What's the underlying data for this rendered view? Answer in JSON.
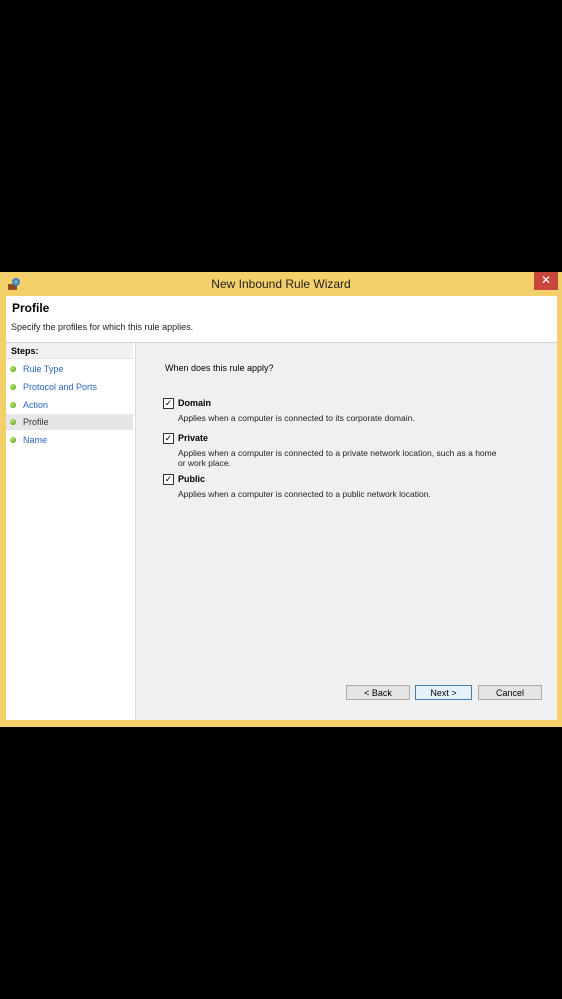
{
  "window": {
    "title": "New Inbound Rule Wizard",
    "close_glyph": "✕"
  },
  "header": {
    "title": "Profile",
    "description": "Specify the profiles for which this rule applies."
  },
  "sidebar": {
    "steps_label": "Steps:",
    "items": [
      {
        "label": "Rule Type"
      },
      {
        "label": "Protocol and Ports"
      },
      {
        "label": "Action"
      },
      {
        "label": "Profile"
      },
      {
        "label": "Name"
      }
    ]
  },
  "main": {
    "question": "When does this rule apply?",
    "options": [
      {
        "label": "Domain",
        "checked": true,
        "description": "Applies when a computer is connected to its corporate domain."
      },
      {
        "label": "Private",
        "checked": true,
        "description_line1": "Applies when a computer is connected to a private network location, such as a home",
        "description_line2": "or work place."
      },
      {
        "label": "Public",
        "checked": true,
        "description": "Applies when a computer is connected to a public network location."
      }
    ]
  },
  "buttons": {
    "back": "< Back",
    "next": "Next >",
    "cancel": "Cancel"
  },
  "colors": {
    "frame": "#f4d06a",
    "close": "#c7463d",
    "link": "#2a66c4"
  },
  "icons": {
    "app": "firewall-icon",
    "step": "green-dot-icon",
    "check": "checkmark-icon"
  }
}
